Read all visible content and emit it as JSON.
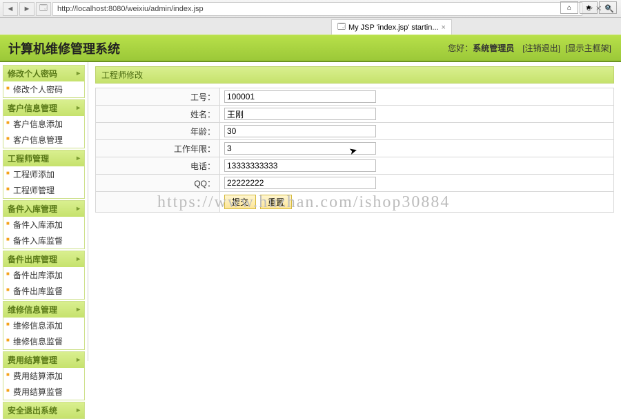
{
  "browser": {
    "url": "http://localhost:8080/weixiu/admin/index.jsp",
    "tab_label": "My JSP 'index.jsp' startin...",
    "search_hint": "🔍"
  },
  "header": {
    "title": "计算机维修管理系统",
    "welcome_prefix": "您好：",
    "role": "系统管理员",
    "logout": "[注销退出]",
    "show_frame": "[显示主框架]"
  },
  "sidebar": [
    {
      "title": "修改个人密码",
      "items": [
        "修改个人密码"
      ]
    },
    {
      "title": "客户信息管理",
      "items": [
        "客户信息添加",
        "客户信息管理"
      ]
    },
    {
      "title": "工程师管理",
      "items": [
        "工程师添加",
        "工程师管理"
      ]
    },
    {
      "title": "备件入库管理",
      "items": [
        "备件入库添加",
        "备件入库监督"
      ]
    },
    {
      "title": "备件出库管理",
      "items": [
        "备件出库添加",
        "备件出库监督"
      ]
    },
    {
      "title": "维修信息管理",
      "items": [
        "维修信息添加",
        "维修信息监督"
      ]
    },
    {
      "title": "费用结算管理",
      "items": [
        "费用结算添加",
        "费用结算监督"
      ]
    },
    {
      "title": "安全退出系统",
      "items": []
    }
  ],
  "panel": {
    "title": "工程师修改",
    "fields": [
      {
        "label": "工号：",
        "value": "100001"
      },
      {
        "label": "姓名：",
        "value": "王刚"
      },
      {
        "label": "年龄：",
        "value": "30"
      },
      {
        "label": "工作年限：",
        "value": "3"
      },
      {
        "label": "电话：",
        "value": "13333333333"
      },
      {
        "label": "QQ：",
        "value": "22222222"
      }
    ],
    "submit": "提交",
    "reset": "重置"
  },
  "watermark": "https://www.huzhan.com/ishop30884"
}
